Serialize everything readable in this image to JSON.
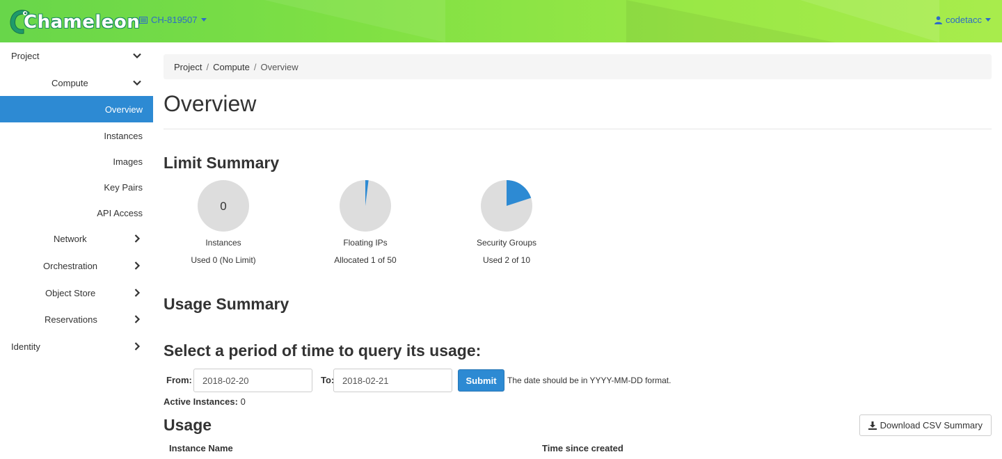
{
  "header": {
    "logo_text": "Chameleon",
    "project_name": "CH-819507",
    "username": "codetacc"
  },
  "sidebar": {
    "items": [
      {
        "label": "Project",
        "expanded": true
      },
      {
        "label": "Compute",
        "expanded": true
      },
      {
        "label": "Overview",
        "active": true
      },
      {
        "label": "Instances"
      },
      {
        "label": "Images"
      },
      {
        "label": "Key Pairs"
      },
      {
        "label": "API Access"
      },
      {
        "label": "Network"
      },
      {
        "label": "Orchestration"
      },
      {
        "label": "Object Store"
      },
      {
        "label": "Reservations"
      },
      {
        "label": "Identity"
      }
    ]
  },
  "breadcrumb": [
    "Project",
    "Compute",
    "Overview"
  ],
  "page_title": "Overview",
  "limit_summary": {
    "title": "Limit Summary",
    "charts": [
      {
        "label": "Instances",
        "value_text": "Used 0 (No Limit)",
        "center_text": "0",
        "used": 0,
        "total": null
      },
      {
        "label": "Floating IPs",
        "value_text": "Allocated 1 of 50",
        "used": 1,
        "total": 50
      },
      {
        "label": "Security Groups",
        "value_text": "Used 2 of 10",
        "used": 2,
        "total": 10
      }
    ],
    "colors": {
      "used": "#2d8ad3",
      "free": "#dddddd"
    }
  },
  "usage_summary": {
    "title": "Usage Summary",
    "query_title": "Select a period of time to query its usage:",
    "from_label": "From:",
    "from_value": "2018-02-20",
    "to_label": "To:",
    "to_value": "2018-02-21",
    "submit_label": "Submit",
    "help_text": "The date should be in YYYY-MM-DD format.",
    "active_instances_label": "Active Instances:",
    "active_instances_value": "0"
  },
  "usage": {
    "title": "Usage",
    "download_label": "Download CSV Summary",
    "columns": [
      "Instance Name",
      "Time since created"
    ]
  },
  "colors": {
    "accent": "#2d8ad3",
    "link": "#2d6ac9",
    "topbar_start": "#68d64a",
    "topbar_end": "#a8ec4c"
  }
}
